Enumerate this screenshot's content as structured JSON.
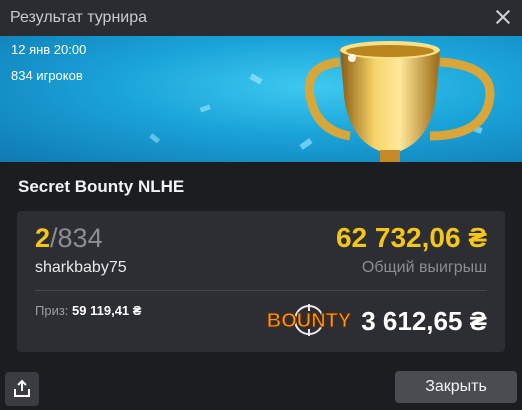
{
  "window": {
    "title": "Результат турнира"
  },
  "banner": {
    "date": "12 янв 20:00",
    "players": "834 игроков"
  },
  "tournament": {
    "name": "Secret Bounty NLHE"
  },
  "result": {
    "place": "2",
    "total": "/834",
    "username": "sharkbaby75",
    "total_win": "62 732,06 ₴",
    "total_win_label": "Общий выигрыш",
    "prize_label": "Приз:",
    "prize_value": "59 119,41 ₴",
    "bounty_logo": "BOUNTY",
    "bounty_value": "3 612,65 ₴"
  },
  "buttons": {
    "close": "Закрыть"
  },
  "icons": {
    "close": "close-icon",
    "share": "share-icon",
    "trophy": "trophy-illustration"
  },
  "colors": {
    "accent_gold": "#f5c518",
    "banner_blue": "#1aa3d8",
    "background": "#1c1d20"
  }
}
